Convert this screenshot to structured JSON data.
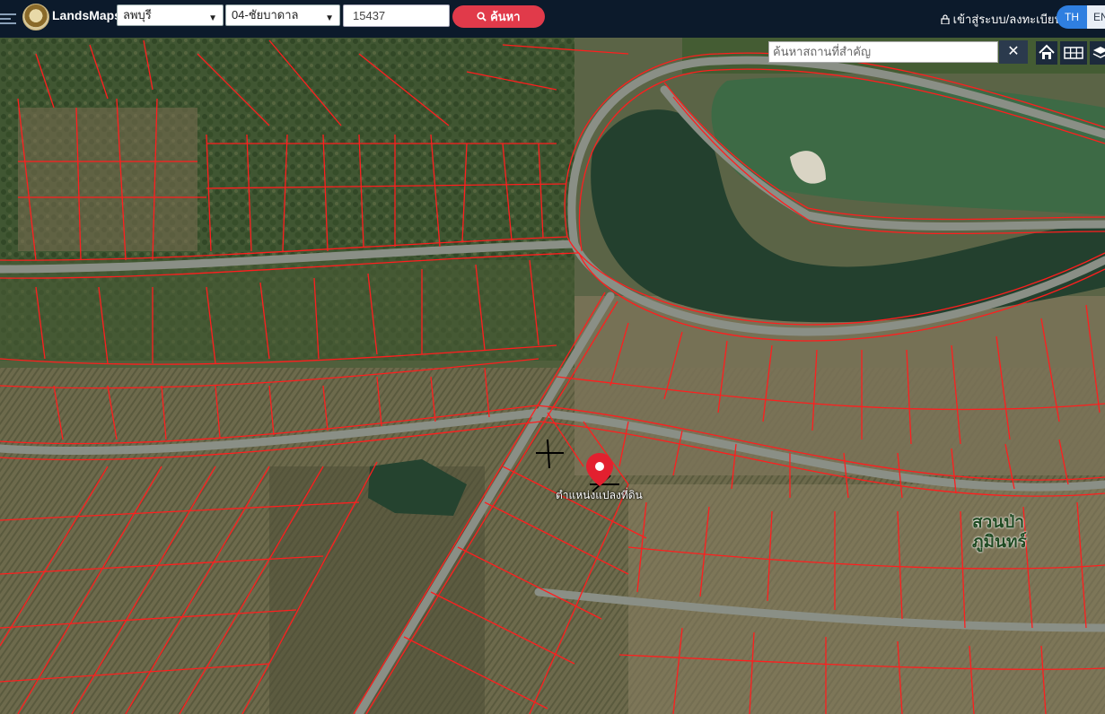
{
  "app": {
    "brand": "LandsMaps"
  },
  "search": {
    "province": "ลพบุรี",
    "district": "04-ชัยบาดาล",
    "parcel_number": "15437",
    "button_label": "ค้นหา"
  },
  "account": {
    "login_label": "เข้าสู่ระบบ/ลงทะเบียน"
  },
  "language": {
    "active": "TH",
    "other": "EN"
  },
  "map": {
    "place_search_placeholder": "ค้นหาสถานที่สำคัญ",
    "close_symbol": "✕",
    "pin_label": "ตำแหน่งแปลงที่ดิน",
    "park_label": "สวนป่า\nภูมินทร์",
    "colors": {
      "parcel_lines": "#ff1e1e",
      "pin": "#e3202f",
      "road": "#8a8f86"
    }
  },
  "icons": [
    "menu-icon",
    "search-icon",
    "lock-icon",
    "home-icon",
    "grid-icon",
    "layers-icon",
    "map-pin-icon"
  ]
}
